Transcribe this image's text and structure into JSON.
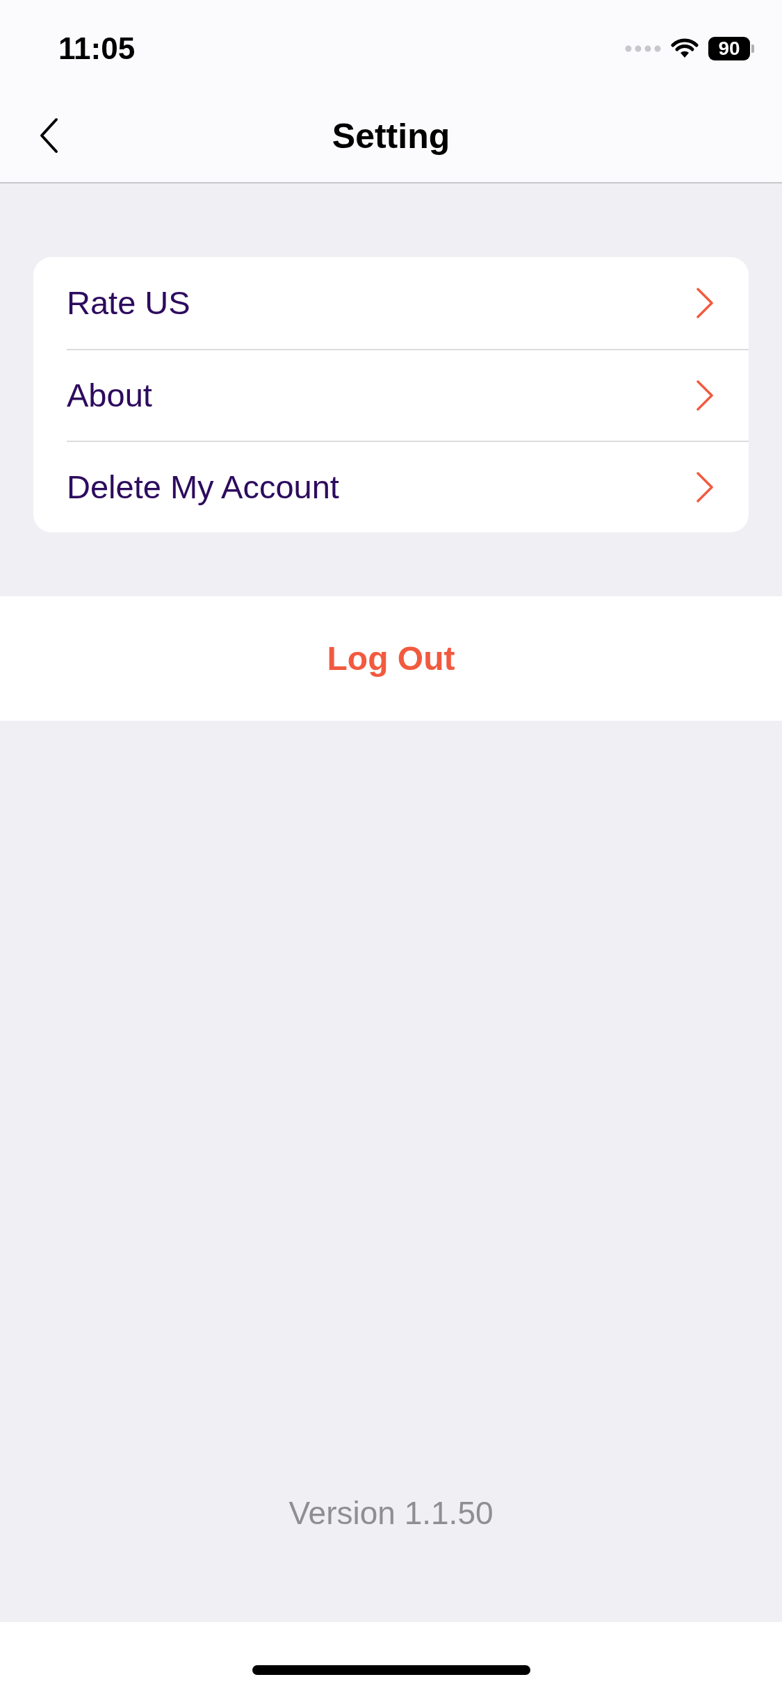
{
  "status_bar": {
    "time": "11:05",
    "battery": "90"
  },
  "nav": {
    "title": "Setting"
  },
  "menu": [
    {
      "label": "Rate US"
    },
    {
      "label": "About"
    },
    {
      "label": "Delete My Account"
    }
  ],
  "logout": "Log Out",
  "version": "Version 1.1.50"
}
